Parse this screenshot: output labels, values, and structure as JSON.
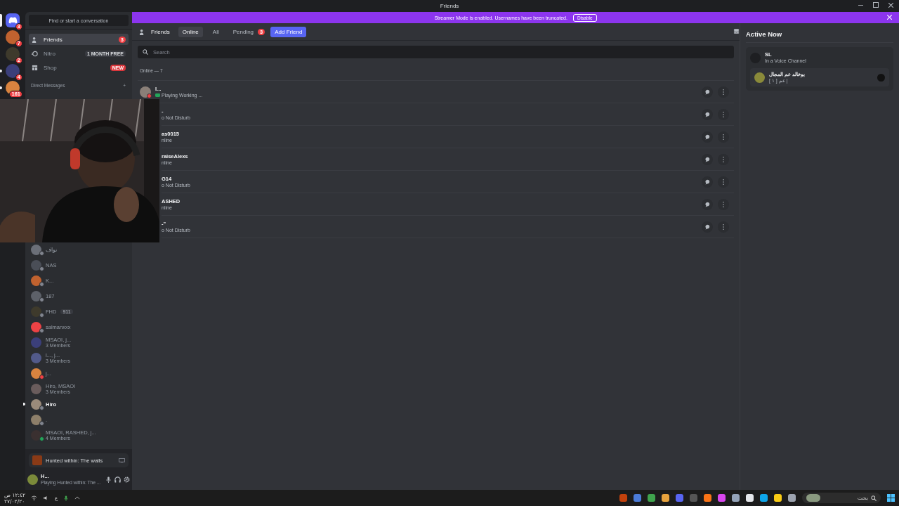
{
  "window": {
    "title": "Friends"
  },
  "banner": {
    "text": "Streamer Mode is enabled. Usernames have been truncated.",
    "button": "Disable"
  },
  "servers": [
    {
      "badge": "3",
      "selected": true,
      "unread": false,
      "kind": "home"
    },
    {
      "badge": "7",
      "selected": false,
      "unread": false,
      "kind": "server"
    },
    {
      "badge": "2",
      "selected": false,
      "unread": false,
      "kind": "server"
    },
    {
      "badge": "4",
      "selected": false,
      "unread": true,
      "kind": "server"
    },
    {
      "badge": "161",
      "selected": false,
      "unread": true,
      "kind": "server"
    }
  ],
  "sidebar": {
    "search": {
      "placeholder": "Find or start a conversation"
    },
    "items": [
      {
        "label": "Friends",
        "selected": true,
        "badge": "3",
        "kind": "friends"
      },
      {
        "label": "Nitro",
        "selected": false,
        "tag": "1 MONTH FREE",
        "kind": "nitro"
      },
      {
        "label": "Shop",
        "selected": false,
        "tag": "NEW",
        "kind": "shop"
      }
    ],
    "dm_header": "Direct Messages",
    "dm_add": "+",
    "dms": [
      {
        "name": "نواف",
        "color": "#80848e",
        "unread": false
      },
      {
        "name": "NAS",
        "color": "#80848e",
        "unread": false
      },
      {
        "name": "K...",
        "color": "#80848e",
        "unread": false
      },
      {
        "name": "187",
        "color": "#80848e",
        "unread": false
      },
      {
        "name": "FHD",
        "tag": "911",
        "color": "#80848e",
        "unread": false
      },
      {
        "name": "salmanxxx",
        "color": "#80848e",
        "unread": false
      },
      {
        "name": "MSAOI, j...",
        "members": "3 Members",
        "unread": false
      },
      {
        "name": "l..., j...",
        "members": "3 Members",
        "unread": false
      },
      {
        "name": "j...",
        "color": "#f23f43",
        "unread": false
      },
      {
        "name": "Hiro, MSAOI",
        "members": "3 Members",
        "unread": false
      },
      {
        "name": "Hiro",
        "color": "#80848e",
        "unread": true
      },
      {
        "name": ".",
        "color": "#80848e",
        "unread": false
      },
      {
        "name": "MSAOI, RASHED, j...",
        "members": "4 Members",
        "color": "#23a55a",
        "unread": false
      }
    ]
  },
  "activity_panel": {
    "title": "Hunted within: The walls"
  },
  "user_panel": {
    "name": "H...",
    "activity": "Playing Hunted within: The ..."
  },
  "tabs": [
    {
      "label": "Friends",
      "kind": "title"
    },
    {
      "label": "Online",
      "kind": "tab",
      "selected": true
    },
    {
      "label": "All",
      "kind": "tab",
      "selected": false
    },
    {
      "label": "Pending",
      "kind": "tab",
      "selected": false,
      "badge": "3"
    },
    {
      "label": "Add Friend",
      "kind": "add"
    }
  ],
  "search": {
    "placeholder": "Search"
  },
  "online_header": "Online — 7",
  "friends": [
    {
      "name": "l...",
      "status_text": "Playing Working ...",
      "kind": "full",
      "playing": true
    },
    {
      "name": "-",
      "status_text": "o Not Disturb",
      "kind": "clipped",
      "playing": false
    },
    {
      "name": "as0015",
      "status_text": "nline",
      "kind": "clipped",
      "playing": false
    },
    {
      "name": "raiseAlexs",
      "status_text": "nline",
      "kind": "clipped",
      "playing": false
    },
    {
      "name": "G14",
      "status_text": "o Not Disturb",
      "kind": "clipped",
      "playing": false
    },
    {
      "name": "ASHED",
      "status_text": "nline",
      "kind": "clipped",
      "playing": false
    },
    {
      "name": "-\"",
      "status_text": "o Not Disturb",
      "kind": "clipped",
      "playing": false
    }
  ],
  "active_now": {
    "title": "Active Now",
    "card": {
      "name": "SL",
      "subtitle": "In a Voice Channel",
      "channel": "بوخالد عم المجال",
      "detail": "عم [ ١ ] |"
    }
  },
  "taskbar": {
    "time": "١٢:٤٢ ص",
    "date": "٢٧/٠٢/٢٠",
    "search_placeholder": "بحث",
    "lang": "ع"
  }
}
